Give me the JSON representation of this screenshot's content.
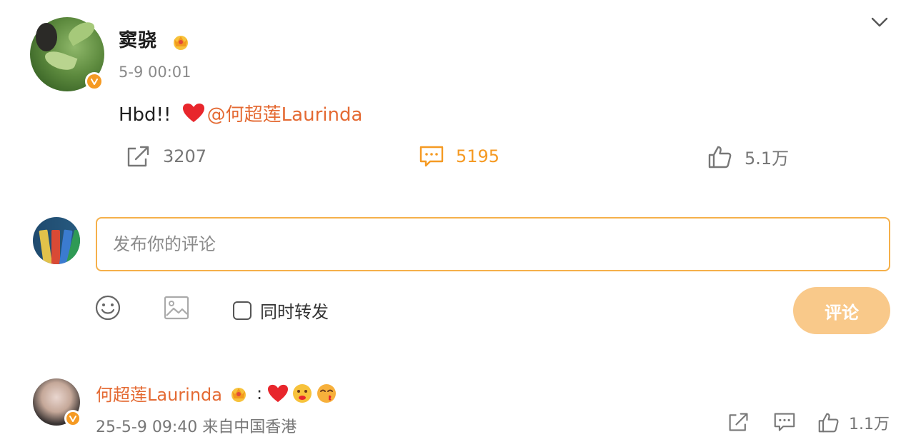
{
  "post": {
    "author": "窦骁",
    "time": "5-9 00:01",
    "text_prefix": "Hbd!! ",
    "mention": "@何超莲Laurinda",
    "repost_count": "3207",
    "comment_count": "5195",
    "like_count": "5.1万"
  },
  "composer": {
    "placeholder": "发布你的评论",
    "repost_label": "同时转发",
    "submit_label": "评论"
  },
  "reply": {
    "author": "何超莲Laurinda",
    "colon": ":",
    "meta": "25-5-9 09:40 来自中国香港",
    "like_count": "1.1万"
  },
  "icons": {
    "verified": "verified-v-badge-icon",
    "crown": "crown-icon",
    "collapse": "chevron-down-icon",
    "repost": "share-arrow-icon",
    "comment": "comment-bubble-icon",
    "like": "thumbs-up-icon",
    "emoji": "smiley-icon",
    "image": "image-icon"
  },
  "colors": {
    "accent_orange": "#f59a23",
    "mention_orange": "#e46a33",
    "submit_disabled": "#f9c98a",
    "input_border": "#f5b04a"
  }
}
